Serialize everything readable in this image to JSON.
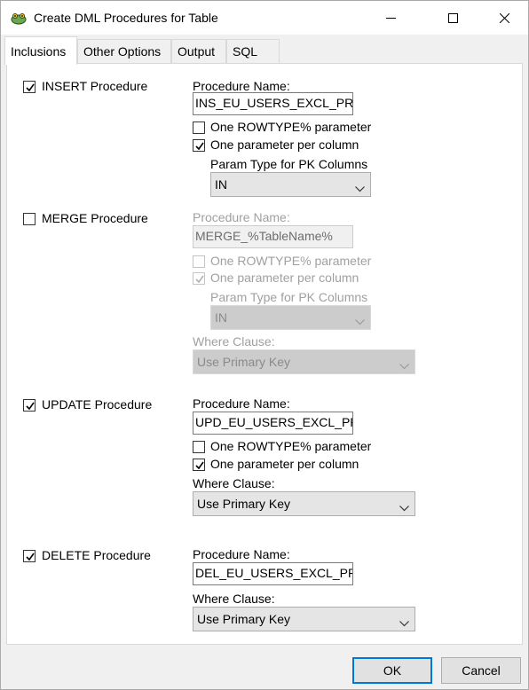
{
  "window": {
    "title": "Create DML Procedures for Table"
  },
  "titlebar_buttons": {
    "minimize_icon": "minimize-icon",
    "maximize_icon": "maximize-icon",
    "close_icon": "close-icon"
  },
  "tabs": [
    {
      "label": "Inclusions",
      "active": true
    },
    {
      "label": "Other Options",
      "active": false
    },
    {
      "label": "Output",
      "active": false
    },
    {
      "label": "SQL",
      "active": false
    }
  ],
  "insert": {
    "label": "INSERT Procedure",
    "checked": true,
    "proc_name_label": "Procedure Name:",
    "proc_name_value": "INS_EU_USERS_EXCL_PRGS",
    "rowtype_label": "One ROWTYPE% parameter",
    "rowtype_checked": false,
    "per_column_label": "One parameter per column",
    "per_column_checked": true,
    "param_type_label": "Param Type for PK Columns",
    "param_type_value": "IN"
  },
  "merge": {
    "label": "MERGE Procedure",
    "checked": false,
    "proc_name_label": "Procedure Name:",
    "proc_name_value": "MERGE_%TableName%",
    "rowtype_label": "One ROWTYPE% parameter",
    "rowtype_checked": false,
    "per_column_label": "One parameter per column",
    "per_column_checked": true,
    "param_type_label": "Param Type for PK Columns",
    "param_type_value": "IN",
    "where_label": "Where Clause:",
    "where_value": "Use Primary Key"
  },
  "update": {
    "label": "UPDATE Procedure",
    "checked": true,
    "proc_name_label": "Procedure Name:",
    "proc_name_value": "UPD_EU_USERS_EXCL_PRG",
    "rowtype_label": "One ROWTYPE% parameter",
    "rowtype_checked": false,
    "per_column_label": "One parameter per column",
    "per_column_checked": true,
    "where_label": "Where Clause:",
    "where_value": "Use Primary Key"
  },
  "delete": {
    "label": "DELETE Procedure",
    "checked": true,
    "proc_name_label": "Procedure Name:",
    "proc_name_value": "DEL_EU_USERS_EXCL_PRGS",
    "where_label": "Where Clause:",
    "where_value": "Use Primary Key"
  },
  "buttons": {
    "ok": "OK",
    "cancel": "Cancel"
  },
  "colors": {
    "default_button_border": "#0078d7",
    "disabled_text": "#a0a0a0"
  }
}
